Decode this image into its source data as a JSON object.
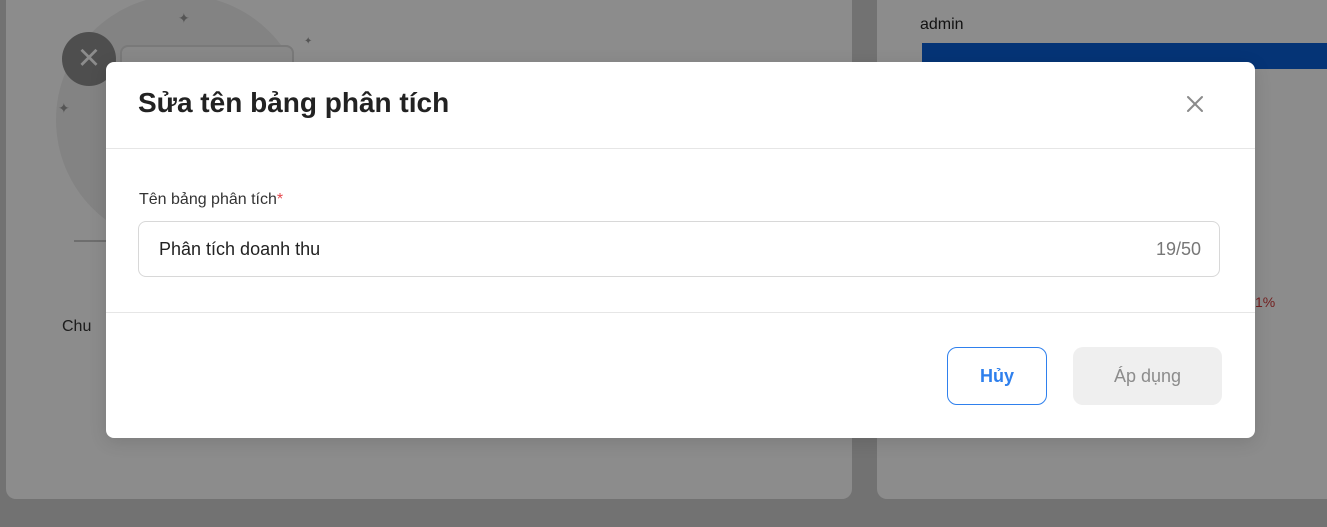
{
  "background": {
    "left_text_fragment": "Chu",
    "right_user_label": "admin",
    "right_percent_fragment": "1%"
  },
  "dialog": {
    "title": "Sửa tên bảng phân tích",
    "field": {
      "label": "Tên bảng phân tích",
      "required_mark": "*",
      "value": "Phân tích doanh thu",
      "counter": "19/50"
    },
    "buttons": {
      "cancel": "Hủy",
      "apply": "Áp dụng"
    }
  },
  "colors": {
    "primary": "#2f80ed",
    "required": "#e5484d",
    "bar_blue": "#0a5fd8"
  },
  "icons": {
    "close": "close-icon",
    "error_circle": "x-circle-icon"
  }
}
